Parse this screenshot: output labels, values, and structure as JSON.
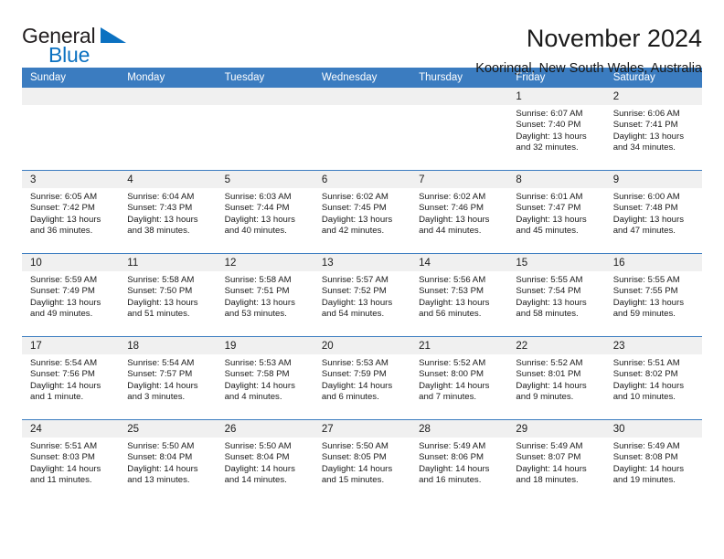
{
  "brand": {
    "name_part1": "General",
    "name_part2": "Blue",
    "accent_color": "#0b71c1"
  },
  "header": {
    "title": "November 2024",
    "subtitle": "Kooringal, New South Wales, Australia"
  },
  "theme": {
    "header_blue": "#3b7cc0",
    "daynum_band": "#f0f0f0"
  },
  "weekdays": [
    "Sunday",
    "Monday",
    "Tuesday",
    "Wednesday",
    "Thursday",
    "Friday",
    "Saturday"
  ],
  "weeks": [
    [
      {
        "day": "",
        "blank": true
      },
      {
        "day": "",
        "blank": true
      },
      {
        "day": "",
        "blank": true
      },
      {
        "day": "",
        "blank": true
      },
      {
        "day": "",
        "blank": true
      },
      {
        "day": "1",
        "sunrise": "Sunrise: 6:07 AM",
        "sunset": "Sunset: 7:40 PM",
        "daylight1": "Daylight: 13 hours",
        "daylight2": "and 32 minutes."
      },
      {
        "day": "2",
        "sunrise": "Sunrise: 6:06 AM",
        "sunset": "Sunset: 7:41 PM",
        "daylight1": "Daylight: 13 hours",
        "daylight2": "and 34 minutes."
      }
    ],
    [
      {
        "day": "3",
        "sunrise": "Sunrise: 6:05 AM",
        "sunset": "Sunset: 7:42 PM",
        "daylight1": "Daylight: 13 hours",
        "daylight2": "and 36 minutes."
      },
      {
        "day": "4",
        "sunrise": "Sunrise: 6:04 AM",
        "sunset": "Sunset: 7:43 PM",
        "daylight1": "Daylight: 13 hours",
        "daylight2": "and 38 minutes."
      },
      {
        "day": "5",
        "sunrise": "Sunrise: 6:03 AM",
        "sunset": "Sunset: 7:44 PM",
        "daylight1": "Daylight: 13 hours",
        "daylight2": "and 40 minutes."
      },
      {
        "day": "6",
        "sunrise": "Sunrise: 6:02 AM",
        "sunset": "Sunset: 7:45 PM",
        "daylight1": "Daylight: 13 hours",
        "daylight2": "and 42 minutes."
      },
      {
        "day": "7",
        "sunrise": "Sunrise: 6:02 AM",
        "sunset": "Sunset: 7:46 PM",
        "daylight1": "Daylight: 13 hours",
        "daylight2": "and 44 minutes."
      },
      {
        "day": "8",
        "sunrise": "Sunrise: 6:01 AM",
        "sunset": "Sunset: 7:47 PM",
        "daylight1": "Daylight: 13 hours",
        "daylight2": "and 45 minutes."
      },
      {
        "day": "9",
        "sunrise": "Sunrise: 6:00 AM",
        "sunset": "Sunset: 7:48 PM",
        "daylight1": "Daylight: 13 hours",
        "daylight2": "and 47 minutes."
      }
    ],
    [
      {
        "day": "10",
        "sunrise": "Sunrise: 5:59 AM",
        "sunset": "Sunset: 7:49 PM",
        "daylight1": "Daylight: 13 hours",
        "daylight2": "and 49 minutes."
      },
      {
        "day": "11",
        "sunrise": "Sunrise: 5:58 AM",
        "sunset": "Sunset: 7:50 PM",
        "daylight1": "Daylight: 13 hours",
        "daylight2": "and 51 minutes."
      },
      {
        "day": "12",
        "sunrise": "Sunrise: 5:58 AM",
        "sunset": "Sunset: 7:51 PM",
        "daylight1": "Daylight: 13 hours",
        "daylight2": "and 53 minutes."
      },
      {
        "day": "13",
        "sunrise": "Sunrise: 5:57 AM",
        "sunset": "Sunset: 7:52 PM",
        "daylight1": "Daylight: 13 hours",
        "daylight2": "and 54 minutes."
      },
      {
        "day": "14",
        "sunrise": "Sunrise: 5:56 AM",
        "sunset": "Sunset: 7:53 PM",
        "daylight1": "Daylight: 13 hours",
        "daylight2": "and 56 minutes."
      },
      {
        "day": "15",
        "sunrise": "Sunrise: 5:55 AM",
        "sunset": "Sunset: 7:54 PM",
        "daylight1": "Daylight: 13 hours",
        "daylight2": "and 58 minutes."
      },
      {
        "day": "16",
        "sunrise": "Sunrise: 5:55 AM",
        "sunset": "Sunset: 7:55 PM",
        "daylight1": "Daylight: 13 hours",
        "daylight2": "and 59 minutes."
      }
    ],
    [
      {
        "day": "17",
        "sunrise": "Sunrise: 5:54 AM",
        "sunset": "Sunset: 7:56 PM",
        "daylight1": "Daylight: 14 hours",
        "daylight2": "and 1 minute."
      },
      {
        "day": "18",
        "sunrise": "Sunrise: 5:54 AM",
        "sunset": "Sunset: 7:57 PM",
        "daylight1": "Daylight: 14 hours",
        "daylight2": "and 3 minutes."
      },
      {
        "day": "19",
        "sunrise": "Sunrise: 5:53 AM",
        "sunset": "Sunset: 7:58 PM",
        "daylight1": "Daylight: 14 hours",
        "daylight2": "and 4 minutes."
      },
      {
        "day": "20",
        "sunrise": "Sunrise: 5:53 AM",
        "sunset": "Sunset: 7:59 PM",
        "daylight1": "Daylight: 14 hours",
        "daylight2": "and 6 minutes."
      },
      {
        "day": "21",
        "sunrise": "Sunrise: 5:52 AM",
        "sunset": "Sunset: 8:00 PM",
        "daylight1": "Daylight: 14 hours",
        "daylight2": "and 7 minutes."
      },
      {
        "day": "22",
        "sunrise": "Sunrise: 5:52 AM",
        "sunset": "Sunset: 8:01 PM",
        "daylight1": "Daylight: 14 hours",
        "daylight2": "and 9 minutes."
      },
      {
        "day": "23",
        "sunrise": "Sunrise: 5:51 AM",
        "sunset": "Sunset: 8:02 PM",
        "daylight1": "Daylight: 14 hours",
        "daylight2": "and 10 minutes."
      }
    ],
    [
      {
        "day": "24",
        "sunrise": "Sunrise: 5:51 AM",
        "sunset": "Sunset: 8:03 PM",
        "daylight1": "Daylight: 14 hours",
        "daylight2": "and 11 minutes."
      },
      {
        "day": "25",
        "sunrise": "Sunrise: 5:50 AM",
        "sunset": "Sunset: 8:04 PM",
        "daylight1": "Daylight: 14 hours",
        "daylight2": "and 13 minutes."
      },
      {
        "day": "26",
        "sunrise": "Sunrise: 5:50 AM",
        "sunset": "Sunset: 8:04 PM",
        "daylight1": "Daylight: 14 hours",
        "daylight2": "and 14 minutes."
      },
      {
        "day": "27",
        "sunrise": "Sunrise: 5:50 AM",
        "sunset": "Sunset: 8:05 PM",
        "daylight1": "Daylight: 14 hours",
        "daylight2": "and 15 minutes."
      },
      {
        "day": "28",
        "sunrise": "Sunrise: 5:49 AM",
        "sunset": "Sunset: 8:06 PM",
        "daylight1": "Daylight: 14 hours",
        "daylight2": "and 16 minutes."
      },
      {
        "day": "29",
        "sunrise": "Sunrise: 5:49 AM",
        "sunset": "Sunset: 8:07 PM",
        "daylight1": "Daylight: 14 hours",
        "daylight2": "and 18 minutes."
      },
      {
        "day": "30",
        "sunrise": "Sunrise: 5:49 AM",
        "sunset": "Sunset: 8:08 PM",
        "daylight1": "Daylight: 14 hours",
        "daylight2": "and 19 minutes."
      }
    ]
  ]
}
